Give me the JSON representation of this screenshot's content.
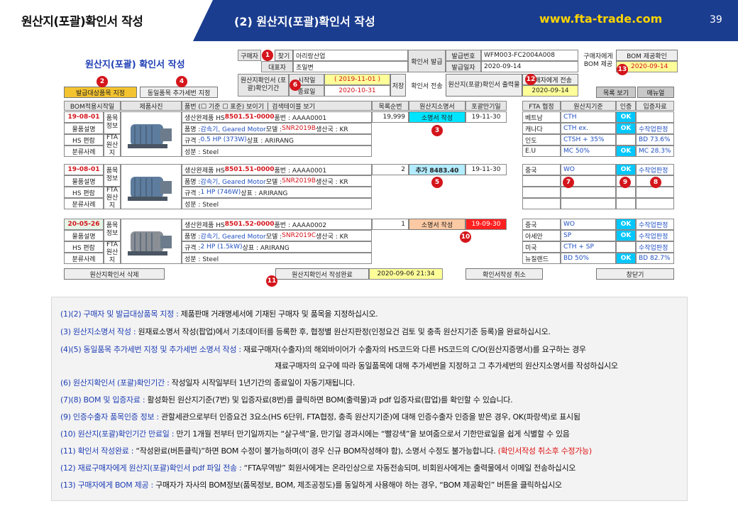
{
  "header": {
    "left_title": "원산지(포괄)확인서 작성",
    "mid_title": "(2) 원산지(포괄)확인서 작성",
    "url": "www.fta-trade.com",
    "page": "39"
  },
  "form": {
    "title": "원산지(포괄) 확인서 작성",
    "buyer_label": "구매자",
    "find_btn": "찾기",
    "buyer_value": "아리랑산업",
    "rep_label": "대표자",
    "rep_value": "조일변",
    "issue_label": "확인서 발급",
    "issue_no_label": "발급번호",
    "issue_no": "WFM003-FC2004A008",
    "issue_date_label": "발급일자",
    "issue_date": "2020-09-14",
    "bom_to_buyer_label": "구매자에게 BOM 제공",
    "bom_confirm_btn": "BOM 제공확인",
    "bom_date": "2020-09-14",
    "period_label": "원산지확인서 (포괄)확인기간",
    "start_label": "시작일",
    "start_date": "( 2019-11-01 )",
    "end_label": "종료일",
    "end_date": "2020-10-31",
    "save_btn": "저장",
    "send_label": "확인서 전송",
    "print_btn": "원산지(포괄)확인서 출력물",
    "send_buyer_btn": "구매자에게 전송",
    "send_date": "2020-09-14",
    "issue_items_btn": "발급대상품목 지정",
    "same_item_btn": "동일품목 추가세번 지정",
    "catalog_btn": "목록 보기",
    "manual_btn": "매뉴얼"
  },
  "columns": {
    "bom_date": "BOM적용시작일",
    "photo": "제품사진",
    "item": "품번 (☐ 기준 ☐ 표준) 보이기 │ 검색테이블 보기",
    "seq": "목록순번",
    "cert": "원산지소명서",
    "expiry": "포괄만기일",
    "fta": "FTA 협정",
    "criteria": "원산지기준",
    "auth": "인증",
    "docs": "입증자료"
  },
  "left_labels": {
    "item_info": "품목 정보",
    "item_desc": "물품설명",
    "hs": "HS 편람",
    "classify": "분류사례",
    "fta_origin": "FTA 원산지"
  },
  "rows": [
    {
      "date": "19-08-01",
      "l1": "생산완제품  HS ",
      "hs": "8501.51-0000",
      "l1b": "  품번 : AAAA0001",
      "l2a": "품명 : ",
      "name": "감속기, Geared Motor",
      "l2b": "  모델 : ",
      "model": "SNR2019B",
      "l2c": "  생산국 : KR",
      "l3a": "규격 : ",
      "spec": "0.5 HP (373W)",
      "l3b": "  상표 : ARIRANG",
      "l4": "성분 : Steel",
      "seq": "19,999",
      "cert": "소명서 작성",
      "expiry": "19-11-30",
      "fta": [
        {
          "a": "베트남",
          "c": "CTH",
          "ok": "OK",
          "d": ""
        },
        {
          "a": "캐나다",
          "c": "CTH ex.",
          "ok": "OK",
          "d": "수작업판정"
        },
        {
          "a": "인도",
          "c": "CTSH + 35%",
          "ok": "",
          "d": "BD 73.6%"
        },
        {
          "a": "E.U",
          "c": "MC 50%",
          "ok": "OK",
          "d": "MC 28.3%"
        }
      ]
    },
    {
      "date": "19-08-01",
      "l1": "생산완제품  HS ",
      "hs": "8501.51-0000",
      "l1b": "  품번 : AAAA0001",
      "l2a": "품명 : ",
      "name": "감속기, Geared Motor",
      "l2b": "  모델 : ",
      "model": "SNR2019B",
      "l2c": "  생산국 : KR",
      "l3a": "규격 : ",
      "spec": "1 HP (746W)",
      "l3b": "  상표 : ARIRANG",
      "l4": "성분 : Steel",
      "seq": "2",
      "cert": "추가  8483.40",
      "expiry": "19-11-30",
      "fta": [
        {
          "a": "중국",
          "c": "WO",
          "ok": "OK",
          "d": "수작업판정"
        },
        {
          "a": "",
          "c": "",
          "ok": "",
          "d": ""
        },
        {
          "a": "",
          "c": "",
          "ok": "",
          "d": ""
        },
        {
          "a": "",
          "c": "",
          "ok": "",
          "d": ""
        }
      ]
    },
    {
      "date": "20-05-26",
      "l1": "생산완제품  HS ",
      "hs": "8501.52-0000",
      "l1b": "  품번 : AAAA0002",
      "l2a": "품명 : ",
      "name": "감속기, Geared Motor",
      "l2b": "  모델 : ",
      "model": "SNR2019C",
      "l2c": "  생산국 : KR",
      "l3a": "규격 : ",
      "spec": "2 HP (1.5kW)",
      "l3b": "  상표 : ARIRANG",
      "l4": "성분 : Steel",
      "seq": "1",
      "cert": "소명서 작성",
      "expiry": "19-09-30",
      "fta": [
        {
          "a": "중국",
          "c": "WO",
          "ok": "OK",
          "d": "수작업판정"
        },
        {
          "a": "아세안",
          "c": "SP",
          "ok": "OK",
          "d": "수작업판정"
        },
        {
          "a": "미국",
          "c": "CTH + SP",
          "ok": "",
          "d": "수작업판정"
        },
        {
          "a": "뉴질랜드",
          "c": "BD 50%",
          "ok": "OK",
          "d": "BD 82.7%"
        }
      ]
    }
  ],
  "bottom": {
    "delete_btn": "원산지확인서 삭제",
    "complete_btn": "원산지확인서 작성완료",
    "complete_date": "2020-09-06  21:34",
    "cancel_btn": "확인서작성 취소",
    "close_btn": "창닫기"
  },
  "info": [
    {
      "k": "(1)(2) 구매자 및 발급대상품목 지정 : ",
      "t": " 제품판매 거래명세서에 기재된 구매자 및 품목을 지정하십시오.",
      "r": ""
    },
    {
      "k": "(3) 원산지소명서 작성 : ",
      "t": " 원재료소명서 작성(팝업)에서 기초데이터를 등록한 후, 협정별 원산지판정(인정요건 검토 및 충족 원산지기준 등록)을 완료하십시오.",
      "r": ""
    },
    {
      "k": "(4)(5) 동일품목 추가세번 지정 및 추가세번 소명서 작성 : ",
      "t": " 재료구매자(수출자)의 해외바이어가 수출자의 HS코드와 다른 HS코드의 C/O(원산지증명서)를 요구하는 경우",
      "r": ""
    },
    {
      "k": "",
      "t": "재료구매자의 요구에 따라 동일품목에 대해 추가세번을 지정하고 그 추가세번의 원산지소명서를 작성하십시오",
      "r": ""
    },
    {
      "k": "(6) 원산지확인서 (포괄)확인기간 : ",
      "t": " 작성일자 시작일부터 1년기간의 종료일이 자동기재됩니다.",
      "r": ""
    },
    {
      "k": "(7)(8) BOM 및 입증자료 : ",
      "t": " 활성화된 원산지기준(7번) 및 입증자료(8번)를 클릭하면 BOM(출력물)과 pdf 입증자료(팝업)를 확인할 수 있습니다.",
      "r": ""
    },
    {
      "k": "(9) 인증수출자 품목인증 정보 : ",
      "t": " 관할세관으로부터 인증요건 3요소(HS 6단위, FTA협정, 충족 원산지기준)에 대해 인증수출자 인증을 받은 경우, OK(파랑색)로 표시됨",
      "r": ""
    },
    {
      "k": "(10) 원산지(포괄)확인기간 만료일 : ",
      "t": " 만기 1개월 전부터 만기일까지는 “살구색”을, 만기일 경과시에는 “빨강색”을 보여줌으로서 기한만료일을 쉽게 식별할 수 있음",
      "r": ""
    },
    {
      "k": "(11) 확인서 작성완료 : ",
      "t": " “작성완료(버튼클릭)”하면 BOM 수정이 불가능하며(이 경우 신규 BOM작성해야 함), 소명서 수정도 불가능합니다. ",
      "r": "(확인서작성 취소후 수정가능)"
    },
    {
      "k": "(12) 재료구매자에게 원산지(포괄)확인서 pdf 파일 전송 : ",
      "t": " “FTA무역방” 회원사에게는 온라인상으로 자동전송되며, 비회원사에게는 출력물에서 이메일 전송하십시오",
      "r": ""
    },
    {
      "k": "(13) 구매자에게 BOM 제공 : ",
      "t": " 구매자가 자사의 BOM정보(품목정보, BOM, 제조공정도)를 동일하게 사용해야 하는 경우, “BOM 제공확인” 버튼을 클릭하십시오",
      "r": ""
    }
  ],
  "badges": [
    "1",
    "2",
    "3",
    "4",
    "5",
    "6",
    "7",
    "8",
    "9",
    "10",
    "11",
    "12",
    "13"
  ]
}
